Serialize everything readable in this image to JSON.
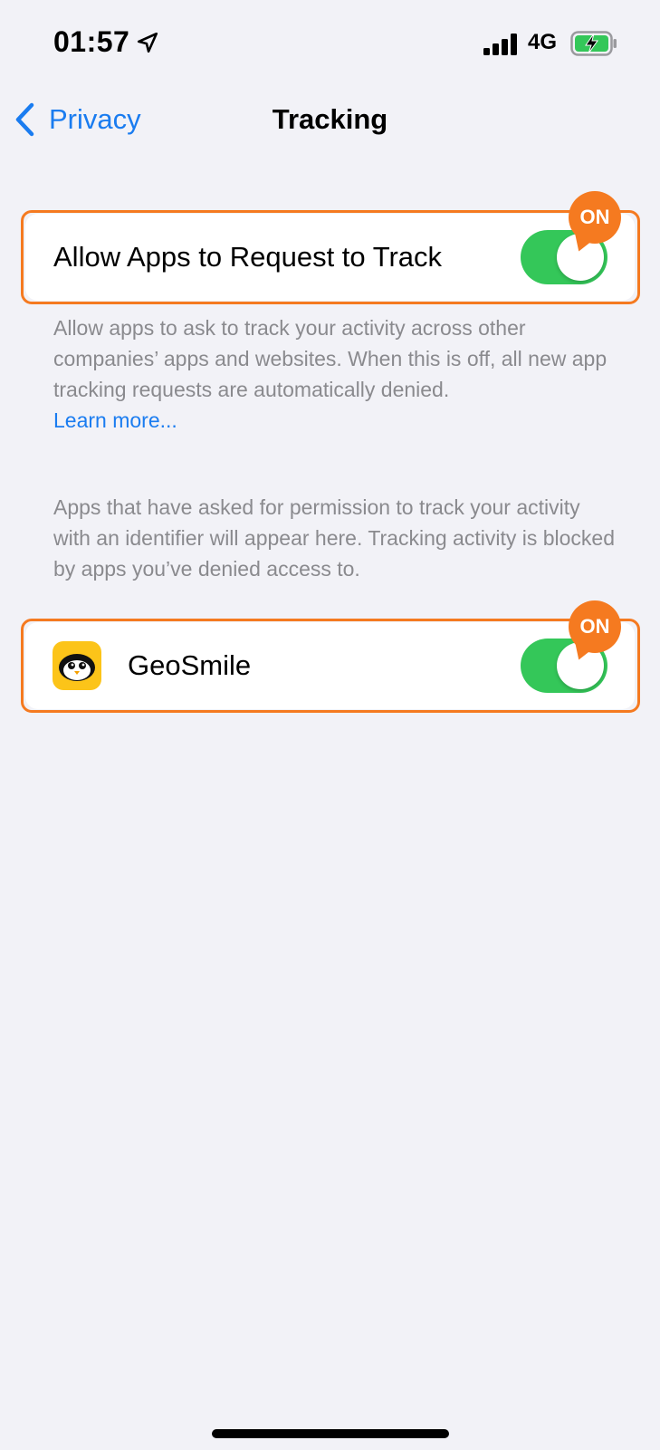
{
  "status_bar": {
    "time": "01:57",
    "network": "4G"
  },
  "nav": {
    "back_label": "Privacy",
    "title": "Tracking"
  },
  "allow_tracking": {
    "label": "Allow Apps to Request to Track",
    "state_badge": "ON"
  },
  "allow_description": {
    "text": "Allow apps to ask to track your activity across other companies’ apps and websites. When this is off, all new app tracking requests are automatically denied.",
    "link": "Learn more..."
  },
  "apps_description": {
    "text": "Apps that have asked for permission to track your activity with an identifier will appear here. Tracking activity is blocked by apps you’ve denied access to."
  },
  "apps": [
    {
      "name": "GeoSmile",
      "state_badge": "ON"
    }
  ],
  "colors": {
    "accent": "#1a7cf0",
    "toggle_on": "#34c759",
    "highlight": "#f57a20",
    "background": "#f2f2f7"
  }
}
